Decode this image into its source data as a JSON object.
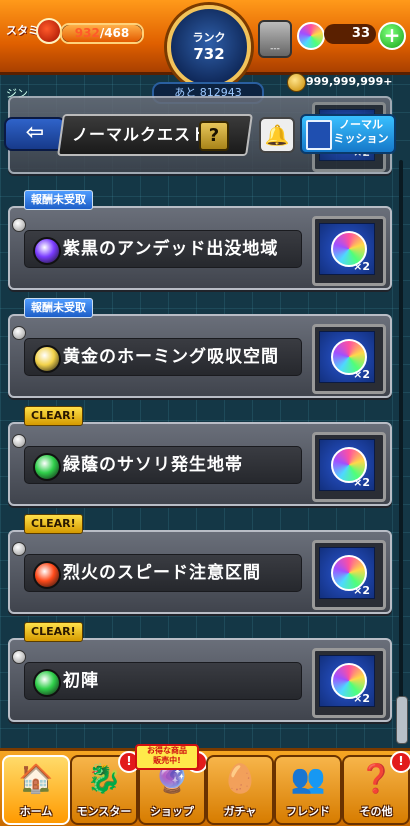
{
  "status": {
    "stamina_label": "スタミナ",
    "stamina_current": "932",
    "stamina_max": "/468",
    "stamina_fill_percent": 100,
    "rank_label": "ランク",
    "rank_value": "732",
    "next_rank_exp": "あと 812943",
    "item_box_count": "---",
    "orb_count": "33",
    "gold": "999,999,999+"
  },
  "header": {
    "behind_title": "ジン",
    "back_icon": "back-arrow-icon",
    "title": "ノーマルクエスト",
    "help_label": "?",
    "bell_icon": "bell-icon",
    "mission_label": "ノーマル\nミッション"
  },
  "quests": [
    {
      "badge": "報酬未受取",
      "badge_type": "unclaimed",
      "name": "紫黒のアンデッド出没地域",
      "element_color": "#7a3cff",
      "reward_count": "×2"
    },
    {
      "badge": "報酬未受取",
      "badge_type": "unclaimed",
      "name": "黄金のホーミング吸収空間",
      "element_color": "#f2d24a",
      "reward_count": "×2"
    },
    {
      "badge": "CLEAR!",
      "badge_type": "clear",
      "name": "緑蔭のサソリ発生地帯",
      "element_color": "#2fcf4a",
      "reward_count": "×2"
    },
    {
      "badge": "CLEAR!",
      "badge_type": "clear",
      "name": "烈火のスピード注意区間",
      "element_color": "#ff4a1a",
      "reward_count": "×2"
    },
    {
      "badge": "CLEAR!",
      "badge_type": "clear",
      "name": "初陣",
      "element_color": "#2fcf4a",
      "reward_count": "×2"
    }
  ],
  "partial_top_quest": {
    "reward_count": "×2"
  },
  "bottom_nav": {
    "home": "ホーム",
    "monster": "モンスター",
    "shop": "ショップ",
    "gacha": "ガチャ",
    "friend": "フレンド",
    "other": "その他",
    "sale_tag": "お得な商品\n販売中!",
    "alert_mark": "!"
  }
}
